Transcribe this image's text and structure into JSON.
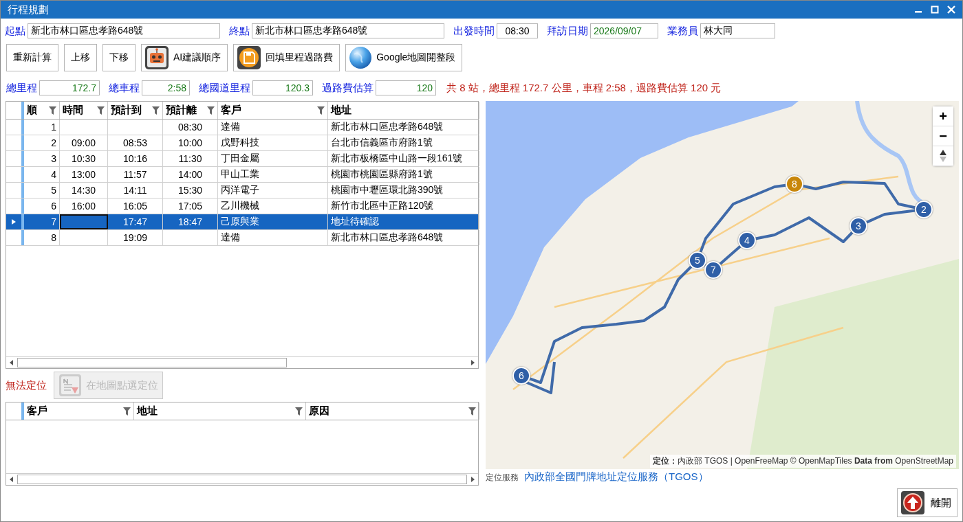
{
  "window": {
    "title": "行程規劃"
  },
  "form": [
    {
      "label": "起點",
      "value": "新北市林口區忠孝路648號",
      "kind": "address"
    },
    {
      "label": "終點",
      "value": "新北市林口區忠孝路648號",
      "kind": "address"
    },
    {
      "label": "出發時間",
      "value": "08:30",
      "kind": "time"
    },
    {
      "label": "拜訪日期",
      "value": "2026/09/07",
      "kind": "date"
    },
    {
      "label": "業務員",
      "value": "林大同",
      "kind": "person"
    }
  ],
  "toolbar": [
    {
      "label": "重新計算",
      "kind": "text"
    },
    {
      "label": "上移",
      "kind": "text"
    },
    {
      "label": "下移",
      "kind": "text"
    },
    {
      "label": "AI建議順序",
      "kind": "robot"
    },
    {
      "label": "回填里程過路費",
      "kind": "floppy"
    },
    {
      "label": "Google地圖開整段",
      "kind": "globe"
    }
  ],
  "stats": [
    {
      "label": "總里程",
      "value": "172.7"
    },
    {
      "label": "總車程",
      "value": "2:58"
    },
    {
      "label": "總國道里程",
      "value": "120.3"
    },
    {
      "label": "過路費估算",
      "value": "120"
    }
  ],
  "summary": "共 8 站，總里程 172.7 公里，車程 2:58，過路費估算 120 元",
  "stops_table": {
    "columns": [
      {
        "label": "順",
        "filter": true
      },
      {
        "label": "時間",
        "filter": true
      },
      {
        "label": "預計到",
        "filter": true
      },
      {
        "label": "預計離",
        "filter": true
      },
      {
        "label": "客戶",
        "filter": true
      },
      {
        "label": "地址",
        "filter": false
      }
    ],
    "rows": [
      {
        "seq": "1",
        "etd": "08:30",
        "customer": "達備",
        "address": "新北市林口區忠孝路648號",
        "selected": false
      },
      {
        "seq": "2",
        "time": "09:00",
        "eta": "08:53",
        "etd": "10:00",
        "customer": "戊野科技",
        "address": "台北市信義區市府路1號",
        "selected": false
      },
      {
        "seq": "3",
        "time": "10:30",
        "eta": "10:16",
        "etd": "11:30",
        "customer": "丁田金屬",
        "address": "新北市板橋區中山路一段161號",
        "selected": false
      },
      {
        "seq": "4",
        "time": "13:00",
        "eta": "11:57",
        "etd": "14:00",
        "customer": "甲山工業",
        "address": "桃園市桃園區縣府路1號",
        "selected": false
      },
      {
        "seq": "5",
        "time": "14:30",
        "eta": "14:11",
        "etd": "15:30",
        "customer": "丙洋電子",
        "address": "桃園市中壢區環北路390號",
        "selected": false
      },
      {
        "seq": "6",
        "time": "16:00",
        "eta": "16:05",
        "etd": "17:05",
        "customer": "乙川機械",
        "address": "新竹市北區中正路120號",
        "selected": false
      },
      {
        "seq": "7",
        "eta": "17:47",
        "etd": "18:47",
        "customer": "己原與業",
        "address": "地址待確認",
        "selected": true
      },
      {
        "seq": "8",
        "eta": "19:09",
        "customer": "達備",
        "address": "新北市林口區忠孝路648號",
        "selected": false
      }
    ]
  },
  "unlocated": {
    "label": "無法定位",
    "button": {
      "label": "在地圖點選定位",
      "disabled": true
    },
    "columns": [
      {
        "label": "客戶",
        "filter": true
      },
      {
        "label": "地址",
        "filter": true
      },
      {
        "label": "原因",
        "filter": true
      }
    ]
  },
  "map": {
    "markers": [
      {
        "label": "2",
        "color": "#2f5fa7"
      },
      {
        "label": "3",
        "color": "#2f5fa7"
      },
      {
        "label": "4",
        "color": "#2f5fa7"
      },
      {
        "label": "5",
        "color": "#2f5fa7"
      },
      {
        "label": "7",
        "color": "#2f5fa7"
      },
      {
        "label": "8",
        "color": "#c8860a"
      },
      {
        "label": "6",
        "color": "#2f5fa7"
      }
    ],
    "zoom_in": "+",
    "zoom_out": "−",
    "attribution": "**定位：**內政部 TGOS | OpenFreeMap © OpenMapTiles **Data from** OpenStreetMap"
  },
  "footer": {
    "label": "定位服務",
    "link": "內政部全國門牌地址定位服務（TGOS）"
  },
  "exit_button": "離開"
}
